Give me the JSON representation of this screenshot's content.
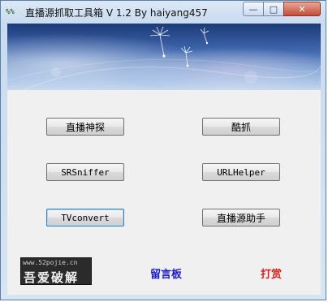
{
  "window": {
    "title": "直播源抓取工具箱   V 1.2    By haiyang457",
    "icon_text": "%%",
    "icon_name": "app-icon",
    "controls": {
      "minimize_glyph": "—",
      "maximize_glyph": "□",
      "close_glyph": "✕"
    }
  },
  "buttons": {
    "live_probe": "直播神探",
    "cool_grab": "酷抓",
    "srsniffer": "SRSniffer",
    "urlhelper": "URLHelper",
    "tvconvert": "TVconvert",
    "live_source_helper": "直播源助手"
  },
  "footer": {
    "logo_url": "www.52pojie.cn",
    "logo_text": "吾爱破解",
    "guestbook": "留言板",
    "reward": "打赏"
  },
  "colors": {
    "link_blue": "#1a1acc",
    "link_red": "#d42020",
    "banner_sky": "#3f66ad"
  }
}
